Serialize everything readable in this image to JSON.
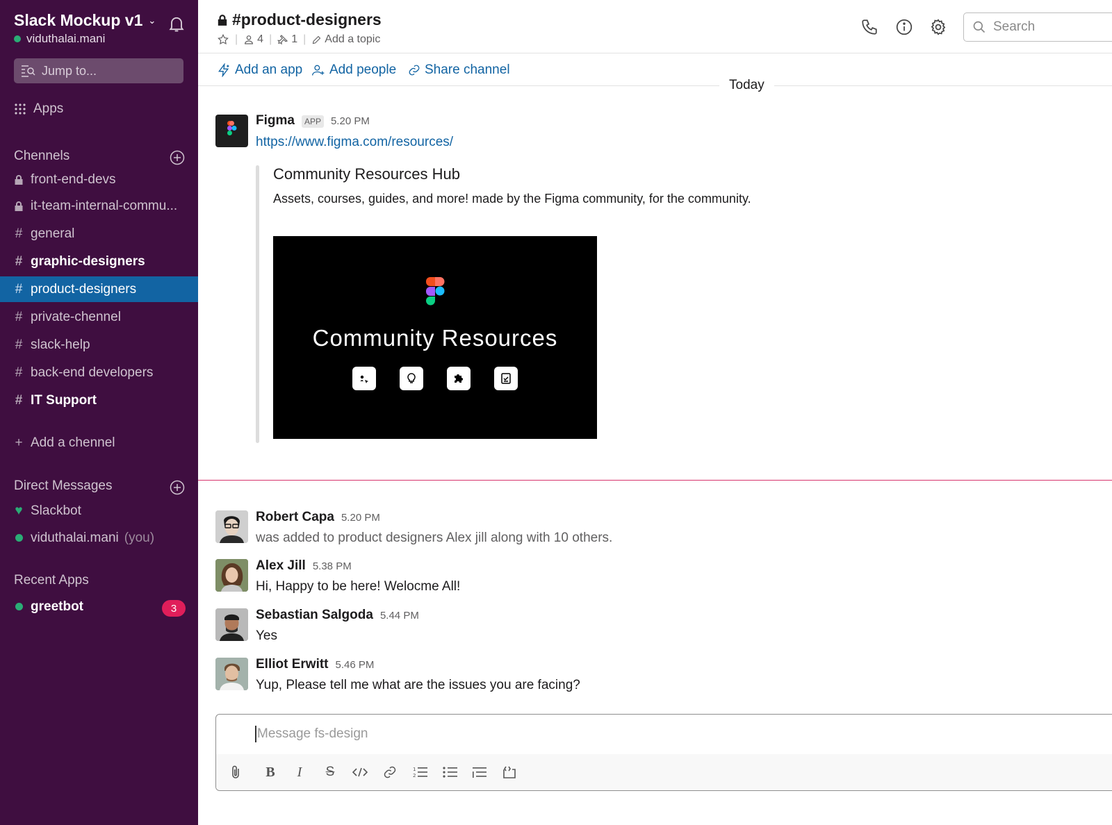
{
  "sidebar": {
    "workspace_name": "Slack Mockup v1",
    "user": "viduthalai.mani",
    "jump_placeholder": "Jump to...",
    "apps_label": "Apps",
    "channels_header": "Chennels",
    "channels": [
      {
        "name": "front-end-devs",
        "icon": "lock-icon"
      },
      {
        "name": "it-team-internal-commu...",
        "icon": "lock-icon"
      },
      {
        "name": "general",
        "icon": "hash"
      },
      {
        "name": "graphic-designers",
        "icon": "hash",
        "bold": true
      },
      {
        "name": "product-designers",
        "icon": "hash",
        "active": true
      },
      {
        "name": "private-chennel",
        "icon": "hash"
      },
      {
        "name": "slack-help",
        "icon": "hash"
      },
      {
        "name": "back-end developers",
        "icon": "hash"
      },
      {
        "name": "IT Support",
        "icon": "hash",
        "bold": true
      }
    ],
    "add_channel": "Add a chennel",
    "dm_header": "Direct Messages",
    "dms": [
      {
        "name": "Slackbot",
        "icon": "heart-icon"
      },
      {
        "name": "viduthalai.mani",
        "suffix": "(you)"
      }
    ],
    "recent_apps_header": "Recent Apps",
    "recent_apps": [
      {
        "name": "greetbot",
        "badge": "3"
      }
    ]
  },
  "header": {
    "channel_name": "#product-designers",
    "members_count": "4",
    "pins_count": "1",
    "add_topic": "Add a topic",
    "search_placeholder": "Search"
  },
  "actions": {
    "add_app": "Add an app",
    "add_people": "Add people",
    "share_channel": "Share channel"
  },
  "day_divider": "Today",
  "figma_message": {
    "sender": "Figma",
    "tag": "APP",
    "time": "5.20 PM",
    "link": "https://www.figma.com/resources/",
    "unfurl_title": "Community Resources Hub",
    "unfurl_desc": "Assets, courses, guides, and more! made by the Figma community, for the community.",
    "preview_title": "Community Resources"
  },
  "messages": [
    {
      "sender": "Robert Capa",
      "time": "5.20 PM",
      "text": "was added to product designers Alex jill along with 10 others."
    },
    {
      "sender": "Alex Jill",
      "time": "5.38 PM",
      "text": "Hi, Happy to be here! Welocme All!"
    },
    {
      "sender": "Sebastian Salgoda",
      "time": "5.44 PM",
      "text": "Yes"
    },
    {
      "sender": "Elliot Erwitt",
      "time": "5.46 PM",
      "text": "Yup, Please tell me what are the issues you are facing?"
    }
  ],
  "composer": {
    "placeholder": "Message fs-design",
    "bold": "B",
    "italic": "I",
    "strike": "S"
  },
  "colors": {
    "sidebar_bg": "#3f0e40",
    "active_bg": "#1264a3",
    "link": "#1264a3",
    "presence": "#2bac76",
    "new_divider": "#d6336c",
    "badge": "#e01e5a"
  }
}
